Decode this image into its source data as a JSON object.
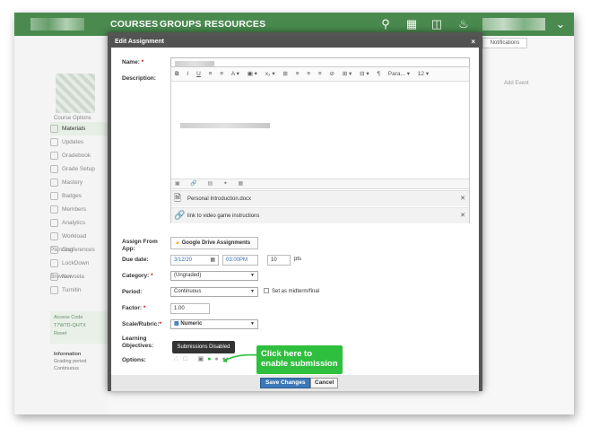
{
  "nav": {
    "courses": "COURSES",
    "groups": "GROUPS",
    "resources": "RESOURCES"
  },
  "icons": {
    "search": "search-icon",
    "apps": "grid-icon",
    "calendar": "calendar-icon",
    "notifications": "bell-icon",
    "menu": "chevron-down-icon"
  },
  "sidebar": {
    "course_options": "Course Options",
    "items": [
      {
        "label": "Materials",
        "active": true
      },
      {
        "label": "Updates"
      },
      {
        "label": "Gradebook"
      },
      {
        "label": "Grade Setup"
      },
      {
        "label": "Mastery"
      },
      {
        "label": "Badges"
      },
      {
        "label": "Members"
      },
      {
        "label": "Analytics"
      },
      {
        "label": "Workload Planning"
      },
      {
        "label": "Conferences"
      },
      {
        "label": "LockDown Browser"
      },
      {
        "label": "Newsela"
      },
      {
        "label": "Turnitin"
      }
    ],
    "access_code_label": "Access Code",
    "access_code_value": "T7W7D-QHTX",
    "access_code_reset": "Reset",
    "information_label": "Information",
    "grading_period_label": "Grading period",
    "grading_period_value": "Continuous"
  },
  "right": {
    "notifications": "Notifications",
    "add_event": "Add Event"
  },
  "modal": {
    "title": "Edit Assignment",
    "close": "×",
    "name_label": "Name:",
    "required": "*",
    "description_label": "Description:",
    "toolbar": [
      "B",
      "I",
      "U",
      "≡",
      "≡",
      "A ▾",
      "▣ ▾",
      "x₂ ▾",
      "⊞",
      "≡",
      "≡",
      "≡",
      "⊘",
      "⊞ ▾",
      "⊟ ▾",
      "¶",
      "Para... ▾",
      "12 ▾"
    ],
    "attachments": [
      {
        "name": "Personal Introduction.docx",
        "icon": "document-icon"
      },
      {
        "name": "link to video game instructions",
        "icon": "link-icon"
      }
    ],
    "assign_from_app_label": "Assign From App:",
    "google_drive_button": "Google Drive Assignments",
    "due_date_label": "Due date:",
    "due_date_value": "3/12/20",
    "due_time_value": "03:00PM",
    "points_value": "10",
    "points_unit": "pts",
    "category_label": "Category:",
    "category_value": "(Ungraded)",
    "period_label": "Period:",
    "period_value": "Continuous",
    "midterm_label": "Set as midterm/final",
    "factor_label": "Factor:",
    "factor_value": "1.00",
    "scale_label": "Scale/Rubric:",
    "scale_value": "Numeric",
    "learning_objectives_label": "Learning Objectives:",
    "options_label": "Options:",
    "tooltip": "Submissions Disabled",
    "callout": "Click here to enable submission",
    "save_button": "Save Changes",
    "cancel_button": "Cancel"
  },
  "colors": {
    "topbar": "#4a8a4f",
    "callout": "#2fbf3e",
    "save": "#3a78b8"
  }
}
